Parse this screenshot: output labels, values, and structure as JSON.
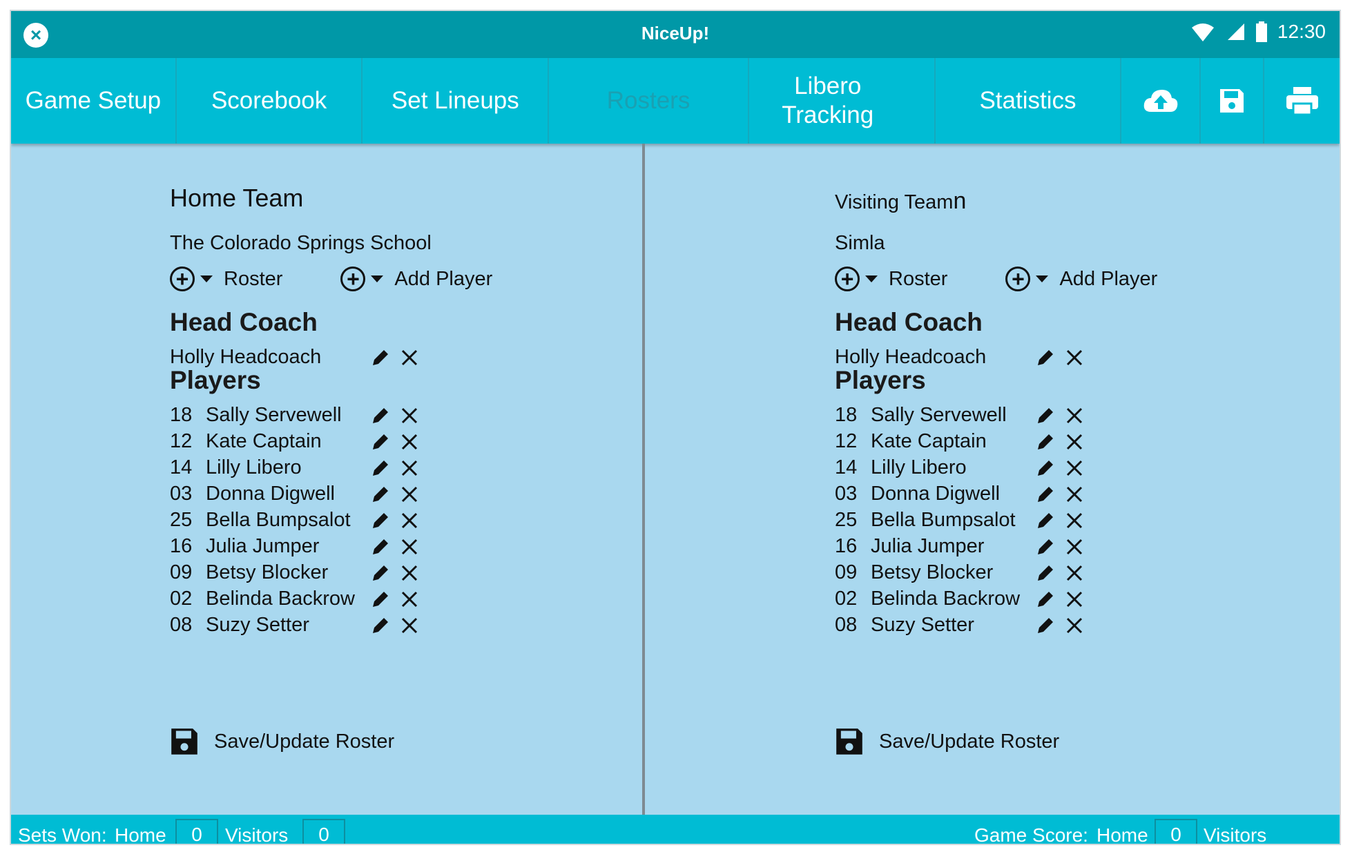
{
  "status_bar": {
    "title": "NiceUp!",
    "time": "12:30",
    "icons": [
      "wifi-icon",
      "signal-icon",
      "battery-icon"
    ]
  },
  "tabs": [
    {
      "label": "Game Setup",
      "active": true
    },
    {
      "label": "Scorebook",
      "active": true
    },
    {
      "label": "Set Lineups",
      "active": true
    },
    {
      "label": "Rosters",
      "active": false
    },
    {
      "label": "Libero Tracking",
      "active": true
    },
    {
      "label": "Statistics",
      "active": true
    }
  ],
  "tab_icons": [
    "cloud-upload-icon",
    "save-icon",
    "print-icon"
  ],
  "home": {
    "heading": "Home Team",
    "team_name": "The Colorado Springs School",
    "roster_label": "Roster",
    "add_player_label": "Add Player",
    "coach_heading": "Head Coach",
    "coach_name": "Holly Headcoach",
    "players_heading": "Players",
    "players": [
      {
        "number": "18",
        "name": "Sally Servewell"
      },
      {
        "number": "12",
        "name": "Kate Captain"
      },
      {
        "number": "14",
        "name": "Lilly Libero"
      },
      {
        "number": "03",
        "name": "Donna Digwell"
      },
      {
        "number": "25",
        "name": "Bella Bumpsalot"
      },
      {
        "number": "16",
        "name": "Julia Jumper"
      },
      {
        "number": "09",
        "name": "Betsy Blocker"
      },
      {
        "number": "02",
        "name": "Belinda Backrow"
      },
      {
        "number": "08",
        "name": "Suzy Setter"
      }
    ],
    "save_label": "Save/Update Roster"
  },
  "visitors": {
    "heading": "Visiting Team",
    "heading_suffix": "n",
    "team_name": "Simla",
    "roster_label": "Roster",
    "add_player_label": "Add Player",
    "coach_heading": "Head Coach",
    "coach_name": "Holly Headcoach",
    "players_heading": "Players",
    "players": [
      {
        "number": "18",
        "name": "Sally Servewell"
      },
      {
        "number": "12",
        "name": "Kate Captain"
      },
      {
        "number": "14",
        "name": "Lilly Libero"
      },
      {
        "number": "03",
        "name": "Donna Digwell"
      },
      {
        "number": "25",
        "name": "Bella Bumpsalot"
      },
      {
        "number": "16",
        "name": "Julia Jumper"
      },
      {
        "number": "09",
        "name": "Betsy Blocker"
      },
      {
        "number": "02",
        "name": "Belinda Backrow"
      },
      {
        "number": "08",
        "name": "Suzy Setter"
      }
    ],
    "save_label": "Save/Update Roster"
  },
  "footer": {
    "sets_won_label": "Sets Won:",
    "home_label": "Home",
    "home_sets": "0",
    "visitors_label": "Visitors",
    "visitors_sets": "0",
    "game_score_label": "Game Score:",
    "game_home_label": "Home",
    "game_home_score": "0",
    "game_visitors_label": "Visitors"
  },
  "colors": {
    "header": "#0098a7",
    "tabbar": "#00bcd4",
    "content": "#a9d8ef",
    "divider": "#7e8a91"
  }
}
